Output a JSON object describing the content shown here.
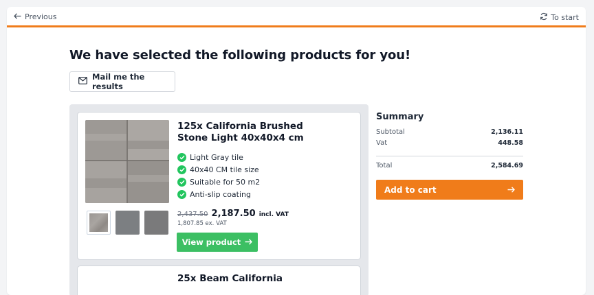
{
  "nav": {
    "previous_label": "Previous",
    "to_start_label": "To start"
  },
  "page": {
    "headline": "We have selected the following products for you!",
    "mail_button_label": "Mail me the results"
  },
  "products": [
    {
      "title": "125x California Brushed Stone Light 40x40x4 cm",
      "features": [
        "Light Gray tile",
        "40x40 CM tile size",
        "Suitable for 50 m2",
        "Anti-slip coating"
      ],
      "old_price": "2,437.50",
      "price": "2,187.50",
      "price_suffix": "incl. VAT",
      "price_ex": "1,807.85 ex. VAT",
      "view_button_label": "View product"
    },
    {
      "title": "25x Beam California"
    }
  ],
  "summary": {
    "title": "Summary",
    "subtotal_label": "Subtotal",
    "subtotal_value": "2,136.11",
    "vat_label": "Vat",
    "vat_value": "448.58",
    "total_label": "Total",
    "total_value": "2,584.69",
    "cart_button_label": "Add to cart"
  },
  "colors": {
    "accent": "#f07c1a",
    "success": "#3cbf63",
    "check": "#22c55e"
  },
  "icons": [
    "arrow-left-icon",
    "refresh-icon",
    "mail-icon",
    "check-circle-icon",
    "arrow-right-icon"
  ]
}
